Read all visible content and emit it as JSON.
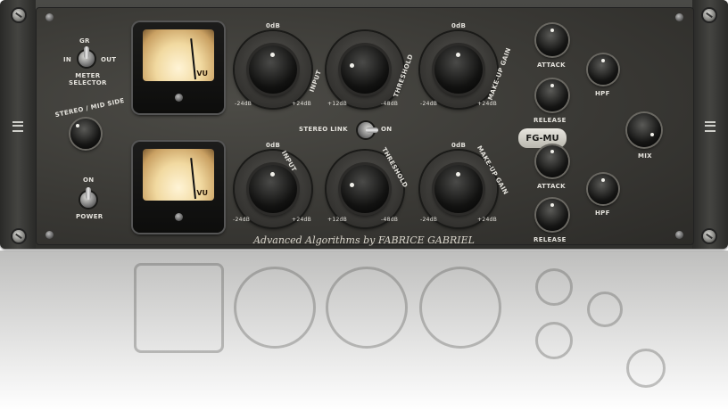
{
  "labels": {
    "gr": "GR",
    "in": "IN",
    "out": "OUT",
    "meter_selector": "METER\nSELECTOR",
    "stereo_mid_side": "STEREO / MID SIDE",
    "on": "ON",
    "power": "POWER",
    "stereo_link": "STEREO LINK",
    "stereo_link_on": "ON",
    "vu": "VU",
    "odb": "0dB",
    "input": "INPUT",
    "threshold": "THRESHOLD",
    "makeup_gain": "MAKE-UP GAIN",
    "attack": "ATTACK",
    "release": "RELEASE",
    "hpf": "HPF",
    "mix": "MIX",
    "minus24": "-24dB",
    "plus24": "+24dB",
    "plus12": "+12dB",
    "minus48": "-48dB",
    "logo": "FG-MU",
    "credit": "Advanced Algorithms by FABRICE GABRIEL"
  }
}
